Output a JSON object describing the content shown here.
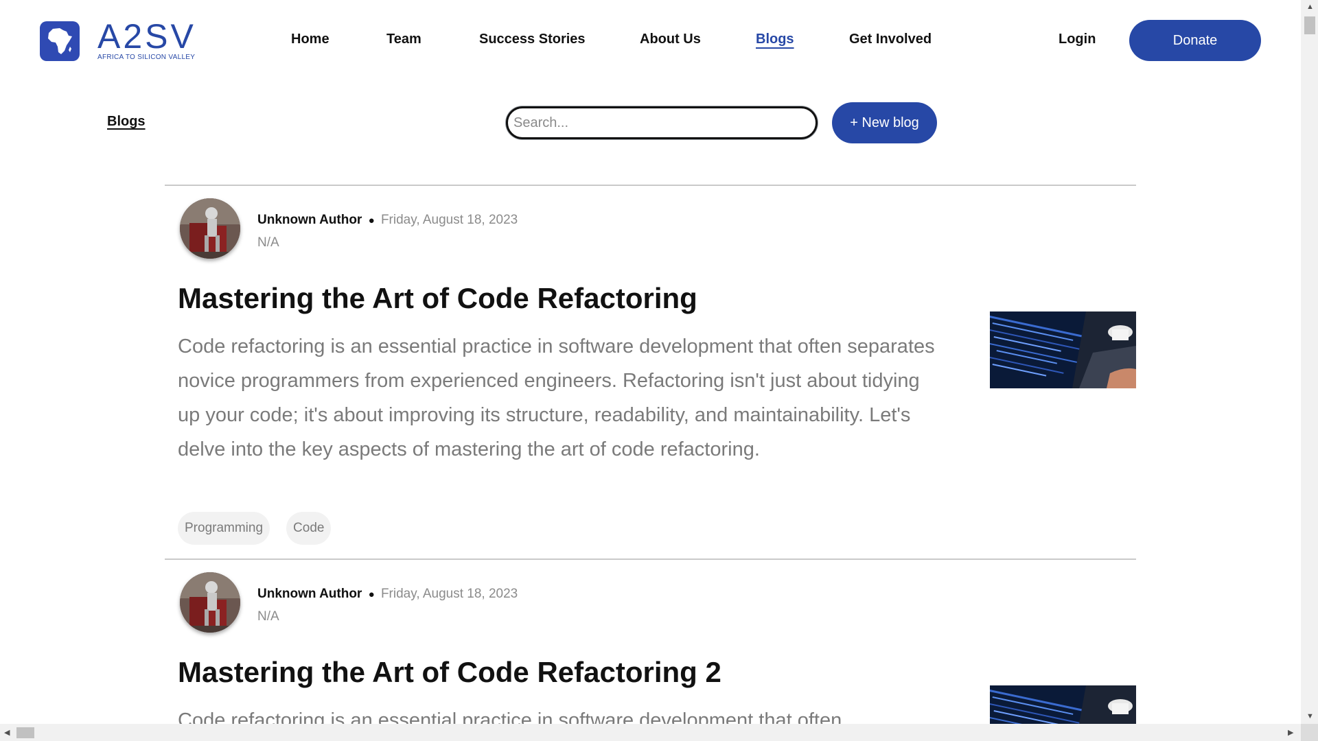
{
  "brand": {
    "logo_text": "A2SV",
    "logo_subtitle": "AFRICA TO SILICON VALLEY"
  },
  "nav": {
    "items": [
      {
        "label": "Home"
      },
      {
        "label": "Team"
      },
      {
        "label": "Success Stories"
      },
      {
        "label": "About Us"
      },
      {
        "label": "Blogs"
      },
      {
        "label": "Get Involved"
      }
    ],
    "login_label": "Login",
    "donate_label": "Donate",
    "active": "Blogs"
  },
  "toolbar": {
    "page_label": "Blogs",
    "search_placeholder": "Search...",
    "search_value": "",
    "new_blog_label": "+ New blog"
  },
  "posts": [
    {
      "author": "Unknown Author",
      "separator": "●",
      "date": "Friday, August 18, 2023",
      "role": "N/A",
      "title": "Mastering the Art of Code Refactoring",
      "excerpt": "Code refactoring is an essential practice in software development that often separates novice programmers from experienced engineers. Refactoring isn't just about tidying up your code; it's about improving its structure, readability, and maintainability. Let's delve into the key aspects of mastering the art of code refactoring.",
      "tags": [
        "Programming",
        "Code"
      ]
    },
    {
      "author": "Unknown Author",
      "separator": "●",
      "date": "Friday, August 18, 2023",
      "role": "N/A",
      "title": "Mastering the Art of Code Refactoring 2",
      "excerpt": "Code refactoring is an essential practice in software development that often"
    }
  ],
  "colors": {
    "brand_blue": "#2748a6",
    "muted_text": "#7a7a7a",
    "tag_bg": "#f2f2f2",
    "divider": "#c9c9c9"
  }
}
